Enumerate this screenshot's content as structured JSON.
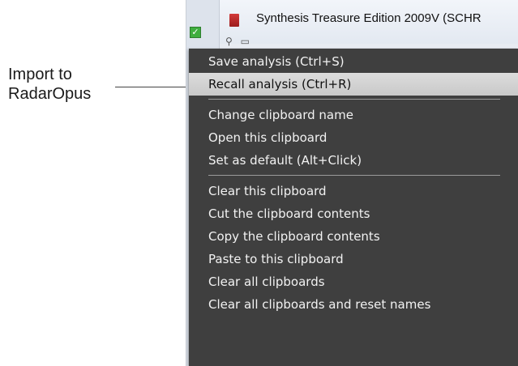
{
  "annotation": {
    "callout_text": "Import to\nRadarOpus"
  },
  "window": {
    "title": "Synthesis Treasure Edition 2009V (SCHR",
    "checkbox_mark": "✓"
  },
  "context_menu": {
    "highlighted_item": "Recall analysis (Ctrl+R)",
    "groups": [
      {
        "items": [
          "Save analysis (Ctrl+S)",
          "Recall analysis (Ctrl+R)"
        ]
      },
      {
        "items": [
          "Change clipboard name",
          "Open this clipboard",
          "Set as default (Alt+Click)"
        ]
      },
      {
        "items": [
          "Clear this clipboard",
          "Cut the clipboard contents",
          "Copy the clipboard contents",
          "Paste to this clipboard",
          "Clear all clipboards",
          "Clear all clipboards and reset names"
        ]
      }
    ]
  },
  "colors": {
    "menu_background": "#3f3f3f",
    "menu_text": "#f2f2f2",
    "highlight_background": "#d4d4d4",
    "checkbox_green": "#3fae3f",
    "app_icon_red": "#b82a2a"
  }
}
